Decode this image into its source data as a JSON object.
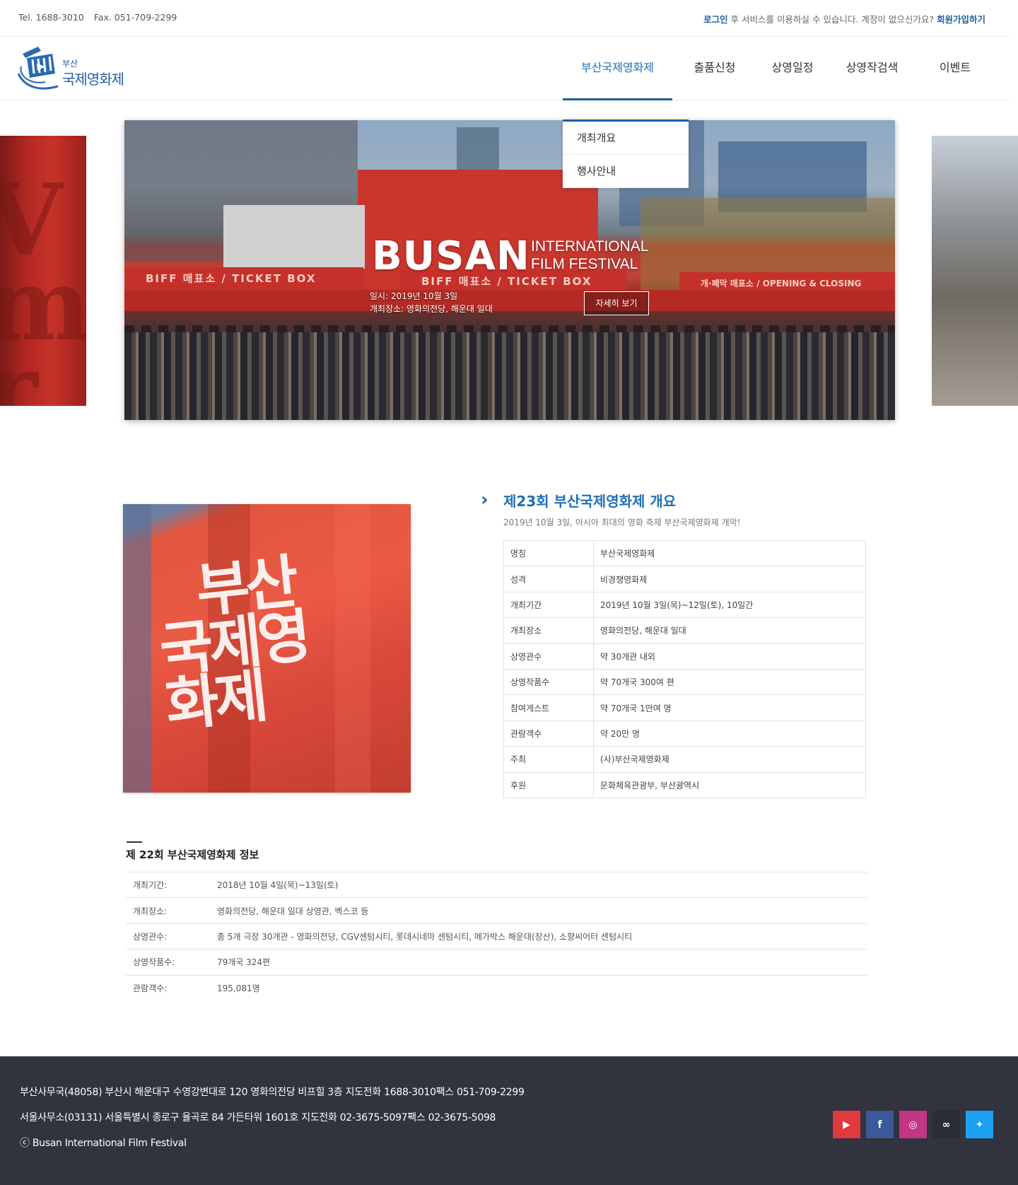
{
  "topbar": {
    "tel": "Tel. 1688-3010",
    "fax": "Fax. 051-709-2299",
    "login_link": "로그인",
    "login_text": " 후 서비스를 이용하실 수 있습니다. 계정이 없으신가요? ",
    "signup_link": "회원가입하기"
  },
  "logo": {
    "small": "부산",
    "big": "국제영화제"
  },
  "nav": [
    "부산국제영화제",
    "출품신청",
    "상영일정",
    "상영작검색",
    "이벤트"
  ],
  "dropdown": [
    "개최개요",
    "행사안내"
  ],
  "banner": {
    "title": "BUSAN",
    "subtitle_1": "INTERNATIONAL",
    "subtitle_2": "FILM FESTIVAL",
    "date": "일시: 2019년 10월 3일",
    "place": "개최장소: 영화의전당, 해운대 일대",
    "button": "자세히 보기",
    "awning_1": "BIFF 매표소 / TICKET BOX",
    "awning_2": "BIFF 매표소 / TICKET BOX",
    "awning_3": "개·폐막 매표소 / OPENING & CLOSING"
  },
  "overview": {
    "title": "제23회 부산국제영화제 개요",
    "subtitle": "2019년 10월 3일, 아시아 최대의 영화 축제 부산국제영화제 개막!",
    "flag_text": [
      "부산",
      "국제영",
      "화제"
    ],
    "rows": [
      [
        "명칭",
        "부산국제영화제"
      ],
      [
        "성격",
        "비경쟁영화제"
      ],
      [
        "개최기간",
        "2019년 10월 3일(목)~12일(토), 10일간"
      ],
      [
        "개최장소",
        "영화의전당, 해운대 일대"
      ],
      [
        "상영관수",
        "약 30개관 내외"
      ],
      [
        "상영작품수",
        "약 70개국 300여 편"
      ],
      [
        "참여게스트",
        "약 70개국 1만여 명"
      ],
      [
        "관람객수",
        "약 20만 명"
      ],
      [
        "주최",
        "(사)부산국제영화제"
      ],
      [
        "후원",
        "문화체육관광부, 부산광역시"
      ]
    ]
  },
  "previous": {
    "title": "제 22회 부산국제영화제 정보",
    "rows": [
      [
        "개최기간:",
        "2018년 10월 4일(목)~13일(토)"
      ],
      [
        "개최장소:",
        "영화의전당, 해운대 일대 상영관, 벡스코 등"
      ],
      [
        "상영관수:",
        "총 5개 극장 30개관 - 영화의전당, CGV센텀시티, 롯데시네마 센텀시티, 메가박스 해운대(장산), 소향씨어터 센텀시티"
      ],
      [
        "상영작품수:",
        "79개국 324편"
      ],
      [
        "관람객수:",
        "195,081명"
      ]
    ]
  },
  "footer": {
    "line1": "부산사무국(48058) 부산시 해운대구 수영강변대로 120 영화의전당 비프힐 3층 지도전화 1688-3010팩스 051-709-2299",
    "line2": "서울사무소(03131) 서울특별시 종로구 율곡로 84 가든타워 1601호 지도전화 02-3675-5097팩스 02-3675-5098",
    "copyright": "ⓒ Busan International Film Festival",
    "socials": [
      {
        "name": "youtube-icon",
        "glyph": "▶",
        "color": "#e03a3e"
      },
      {
        "name": "facebook-icon",
        "glyph": "f",
        "color": "#3b5998"
      },
      {
        "name": "instagram-icon",
        "glyph": "◎",
        "color": "#c13584"
      },
      {
        "name": "link-icon",
        "glyph": "∞",
        "color": "#2a2c36"
      },
      {
        "name": "twitter-icon",
        "glyph": "✦",
        "color": "#1da1f2"
      }
    ]
  }
}
